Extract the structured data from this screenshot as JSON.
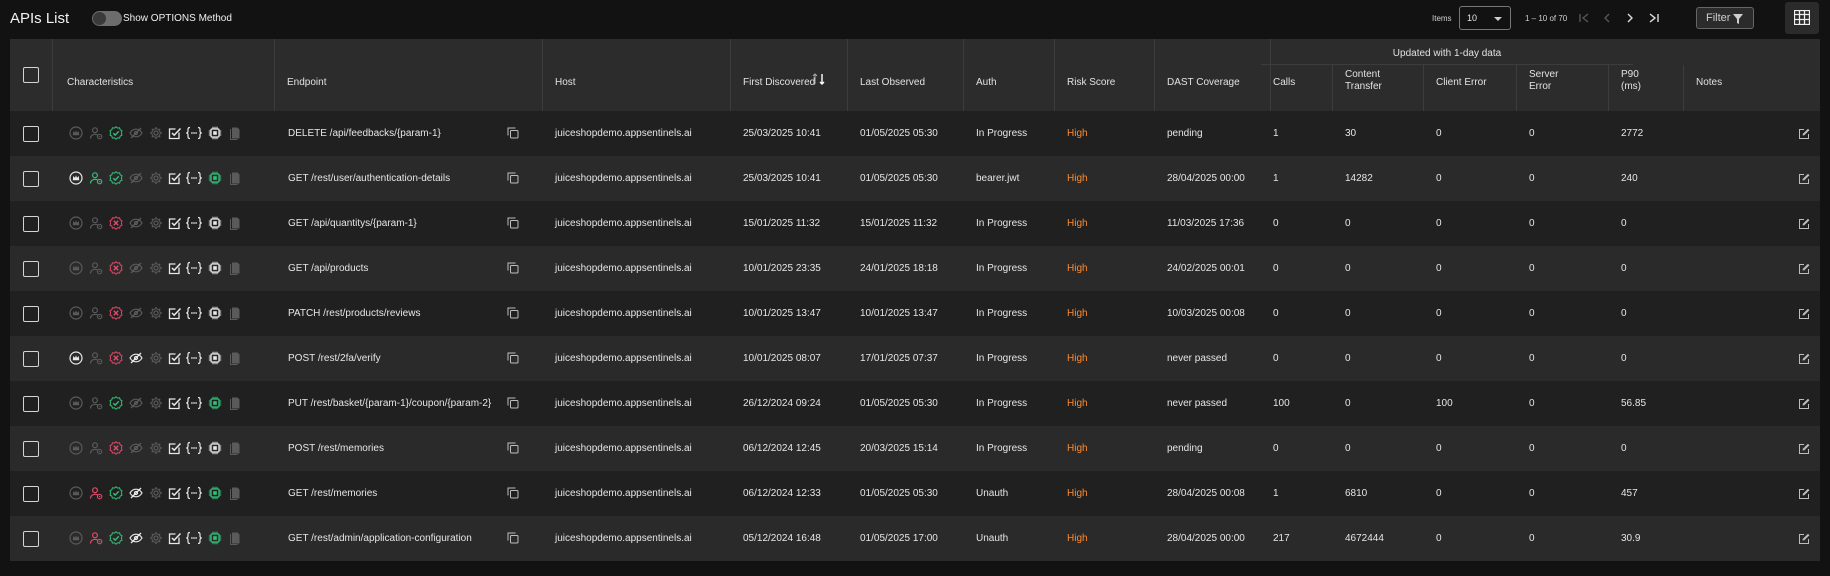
{
  "header": {
    "title": "APIs List",
    "toggle_label": "Show OPTIONS Method",
    "items_label": "Items",
    "items_per_page": "10",
    "range_label": "1 – 10 of 70",
    "filter_label": "Filter"
  },
  "colors": {
    "background": "#121212",
    "header_row": "#2c2c2c",
    "row": "#202020",
    "row_alt": "#2a2a2a",
    "risk_high": "#ff8a2a",
    "icon_green": "#33c17a",
    "icon_red": "#e24a6a",
    "icon_dim": "#5a5a5a",
    "icon_white": "#e8e8e8"
  },
  "table": {
    "columns": {
      "characteristics": "Characteristics",
      "endpoint": "Endpoint",
      "host": "Host",
      "first_discovered": "First Discovered",
      "last_observed": "Last Observed",
      "auth": "Auth",
      "risk_score": "Risk Score",
      "dast_coverage": "DAST Coverage",
      "group": "Updated with 1-day data",
      "calls": "Calls",
      "content_transfer_1": "Content",
      "content_transfer_2": "Transfer",
      "client_error": "Client Error",
      "server_error_1": "Server",
      "server_error_2": "Error",
      "p90_1": "P90",
      "p90_2": "(ms)",
      "notes": "Notes"
    },
    "rows": [
      {
        "endpoint": "DELETE /api/feedbacks/{param-1}",
        "host": "juiceshopdemo.appsentinels.ai",
        "first_discovered": "25/03/2025 10:41",
        "last_observed": "01/05/2025 05:30",
        "auth": "In Progress",
        "risk": "High",
        "dast": "pending",
        "calls": "1",
        "content_transfer": "30",
        "client_error": "0",
        "server_error": "0",
        "p90": "2772",
        "icons": {
          "crown": "dim",
          "user": "dim",
          "check": "green",
          "eye": "dim",
          "gear": "dim",
          "doc": "white",
          "braces": "white",
          "chip": "white",
          "file": "dim"
        }
      },
      {
        "endpoint": "GET /rest/user/authentication-details",
        "host": "juiceshopdemo.appsentinels.ai",
        "first_discovered": "25/03/2025 10:41",
        "last_observed": "01/05/2025 05:30",
        "auth": "bearer.jwt",
        "risk": "High",
        "dast": "28/04/2025 00:00",
        "calls": "1",
        "content_transfer": "14282",
        "client_error": "0",
        "server_error": "0",
        "p90": "240",
        "icons": {
          "crown": "white",
          "user": "green",
          "check": "green",
          "eye": "dim",
          "gear": "dim",
          "doc": "white",
          "braces": "white",
          "chip": "green",
          "file": "dim"
        }
      },
      {
        "endpoint": "GET /api/quantitys/{param-1}",
        "host": "juiceshopdemo.appsentinels.ai",
        "first_discovered": "15/01/2025 11:32",
        "last_observed": "15/01/2025 11:32",
        "auth": "In Progress",
        "risk": "High",
        "dast": "11/03/2025 17:36",
        "calls": "0",
        "content_transfer": "0",
        "client_error": "0",
        "server_error": "0",
        "p90": "0",
        "icons": {
          "crown": "dim",
          "user": "dim",
          "check": "red",
          "eye": "dim",
          "gear": "dim",
          "doc": "white",
          "braces": "white",
          "chip": "white",
          "file": "dim"
        }
      },
      {
        "endpoint": "GET /api/products",
        "host": "juiceshopdemo.appsentinels.ai",
        "first_discovered": "10/01/2025 23:35",
        "last_observed": "24/01/2025 18:18",
        "auth": "In Progress",
        "risk": "High",
        "dast": "24/02/2025 00:01",
        "calls": "0",
        "content_transfer": "0",
        "client_error": "0",
        "server_error": "0",
        "p90": "0",
        "icons": {
          "crown": "dim",
          "user": "dim",
          "check": "red",
          "eye": "dim",
          "gear": "dim",
          "doc": "white",
          "braces": "white",
          "chip": "white",
          "file": "dim"
        }
      },
      {
        "endpoint": "PATCH /rest/products/reviews",
        "host": "juiceshopdemo.appsentinels.ai",
        "first_discovered": "10/01/2025 13:47",
        "last_observed": "10/01/2025 13:47",
        "auth": "In Progress",
        "risk": "High",
        "dast": "10/03/2025 00:08",
        "calls": "0",
        "content_transfer": "0",
        "client_error": "0",
        "server_error": "0",
        "p90": "0",
        "icons": {
          "crown": "dim",
          "user": "dim",
          "check": "red",
          "eye": "dim",
          "gear": "dim",
          "doc": "white",
          "braces": "white",
          "chip": "white",
          "file": "dim"
        }
      },
      {
        "endpoint": "POST /rest/2fa/verify",
        "host": "juiceshopdemo.appsentinels.ai",
        "first_discovered": "10/01/2025 08:07",
        "last_observed": "17/01/2025 07:37",
        "auth": "In Progress",
        "risk": "High",
        "dast": "never passed",
        "calls": "0",
        "content_transfer": "0",
        "client_error": "0",
        "server_error": "0",
        "p90": "0",
        "icons": {
          "crown": "white",
          "user": "dim",
          "check": "red",
          "eye": "white",
          "gear": "dim",
          "doc": "white",
          "braces": "white",
          "chip": "white",
          "file": "dim"
        }
      },
      {
        "endpoint": "PUT /rest/basket/{param-1}/coupon/{param-2}",
        "host": "juiceshopdemo.appsentinels.ai",
        "first_discovered": "26/12/2024 09:24",
        "last_observed": "01/05/2025 05:30",
        "auth": "In Progress",
        "risk": "High",
        "dast": "never passed",
        "calls": "100",
        "content_transfer": "0",
        "client_error": "100",
        "server_error": "0",
        "p90": "56.85",
        "icons": {
          "crown": "dim",
          "user": "dim",
          "check": "green",
          "eye": "dim",
          "gear": "dim",
          "doc": "white",
          "braces": "white",
          "chip": "green",
          "file": "dim"
        }
      },
      {
        "endpoint": "POST /rest/memories",
        "host": "juiceshopdemo.appsentinels.ai",
        "first_discovered": "06/12/2024 12:45",
        "last_observed": "20/03/2025 15:14",
        "auth": "In Progress",
        "risk": "High",
        "dast": "pending",
        "calls": "0",
        "content_transfer": "0",
        "client_error": "0",
        "server_error": "0",
        "p90": "0",
        "icons": {
          "crown": "dim",
          "user": "dim",
          "check": "red",
          "eye": "dim",
          "gear": "dim",
          "doc": "white",
          "braces": "white",
          "chip": "white",
          "file": "dim"
        }
      },
      {
        "endpoint": "GET /rest/memories",
        "host": "juiceshopdemo.appsentinels.ai",
        "first_discovered": "06/12/2024 12:33",
        "last_observed": "01/05/2025 05:30",
        "auth": "Unauth",
        "risk": "High",
        "dast": "28/04/2025 00:08",
        "calls": "1",
        "content_transfer": "6810",
        "client_error": "0",
        "server_error": "0",
        "p90": "457",
        "icons": {
          "crown": "dim",
          "user": "red",
          "check": "green",
          "eye": "white",
          "gear": "dim",
          "doc": "white",
          "braces": "white",
          "chip": "green",
          "file": "dim"
        }
      },
      {
        "endpoint": "GET /rest/admin/application-configuration",
        "host": "juiceshopdemo.appsentinels.ai",
        "first_discovered": "05/12/2024 16:48",
        "last_observed": "01/05/2025 17:00",
        "auth": "Unauth",
        "risk": "High",
        "dast": "28/04/2025 00:00",
        "calls": "217",
        "content_transfer": "4672444",
        "client_error": "0",
        "server_error": "0",
        "p90": "30.9",
        "icons": {
          "crown": "dim",
          "user": "red",
          "check": "green",
          "eye": "white",
          "gear": "dim",
          "doc": "white",
          "braces": "white",
          "chip": "green",
          "file": "dim"
        }
      }
    ]
  }
}
